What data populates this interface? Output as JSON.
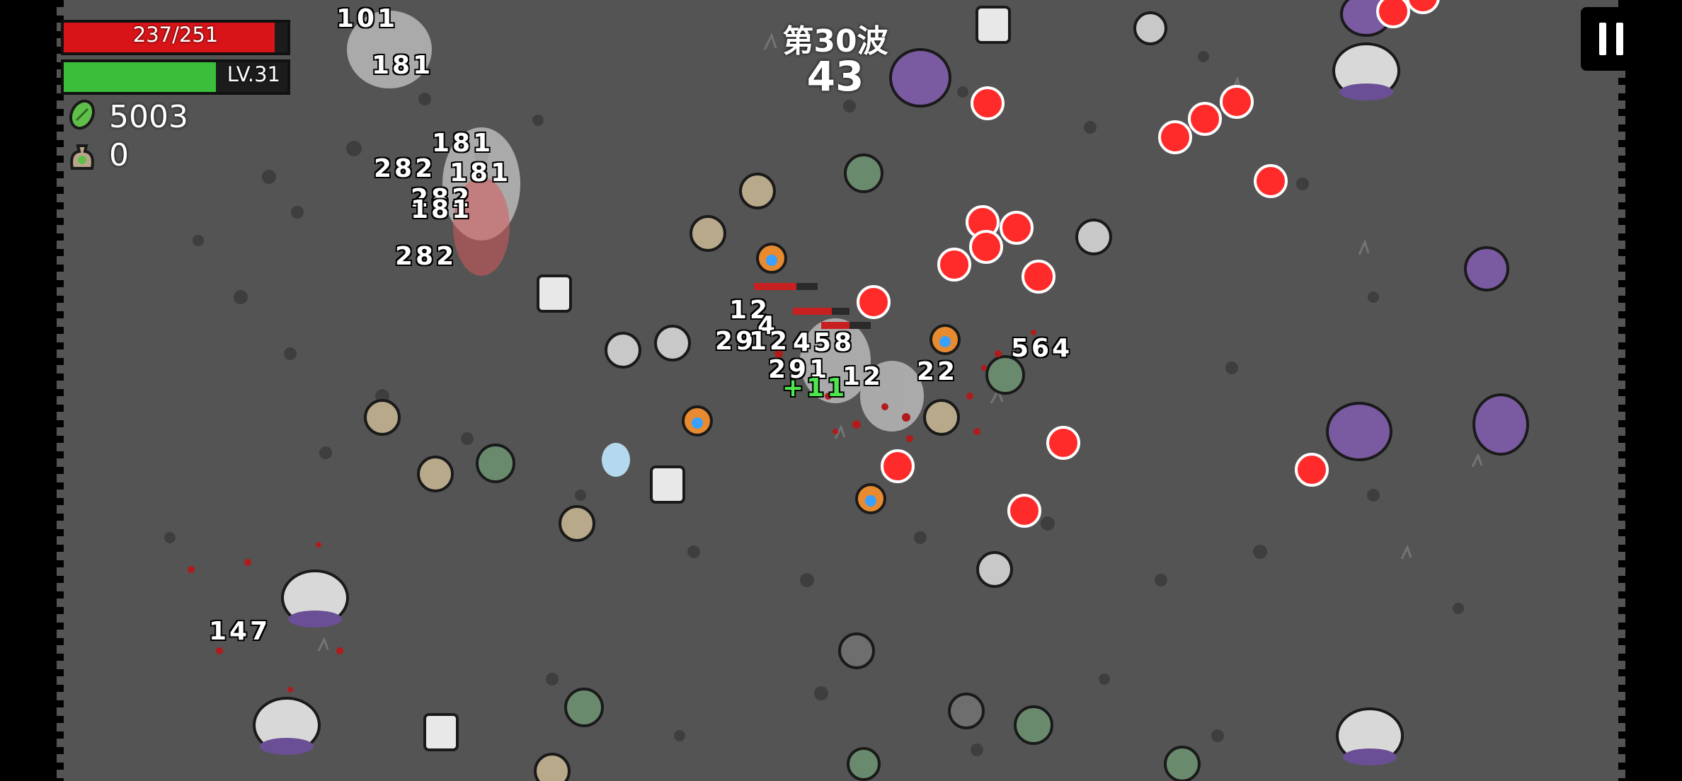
{
  "hud": {
    "health": {
      "current": 237,
      "max": 251,
      "text": "237/251",
      "color": "#d81418"
    },
    "experience": {
      "fraction": 0.68,
      "level_text": "LV.31",
      "color": "#3bbf3b"
    },
    "materials": {
      "icon": "green-material-icon",
      "count": "5003"
    },
    "bag": {
      "icon": "money-bag-icon",
      "count": "0"
    }
  },
  "wave": {
    "title": "第30波",
    "timer": "43"
  },
  "pause": {
    "icon": "pause-icon"
  },
  "damage_numbers": [
    "101",
    "181",
    "181",
    "282",
    "181",
    "282",
    "181",
    "282",
    "12",
    "4",
    "29",
    "12",
    "458",
    "291",
    "12",
    "22",
    "564",
    "147"
  ],
  "heal_number": "+11",
  "colors": {
    "arena": "#545454",
    "enemy_projectile": "#ff2a2a",
    "tree_enemy": "#7a5aa0"
  }
}
